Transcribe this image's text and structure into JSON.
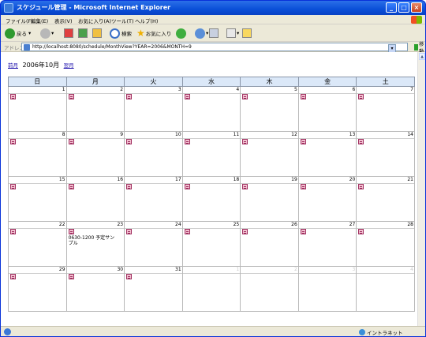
{
  "window": {
    "title": "スケジュール管理 - Microsoft Internet Explorer"
  },
  "menu": [
    "ファイル(F)",
    "編集(E)",
    "表示(V)",
    "お気に入り(A)",
    "ツール(T)",
    "ヘルプ(H)"
  ],
  "toolbar": {
    "back": "戻る",
    "search": "検索",
    "favorites": "お気に入り"
  },
  "address": {
    "label": "アドレス(D)",
    "url": "http://localhost:8080/schedule/MonthView?YEAR=2006&MONTH=9",
    "go": "移動"
  },
  "nav": {
    "prev": "前月",
    "current": "2006年10月",
    "next": "翌月"
  },
  "weekdays": [
    "日",
    "月",
    "火",
    "水",
    "木",
    "金",
    "土"
  ],
  "weeks": [
    [
      {
        "day": "1"
      },
      {
        "day": "2"
      },
      {
        "day": "3"
      },
      {
        "day": "4"
      },
      {
        "day": "5"
      },
      {
        "day": "6"
      },
      {
        "day": "7"
      }
    ],
    [
      {
        "day": "8"
      },
      {
        "day": "9"
      },
      {
        "day": "10"
      },
      {
        "day": "11"
      },
      {
        "day": "12"
      },
      {
        "day": "13"
      },
      {
        "day": "14"
      }
    ],
    [
      {
        "day": "15"
      },
      {
        "day": "16"
      },
      {
        "day": "17"
      },
      {
        "day": "18"
      },
      {
        "day": "19"
      },
      {
        "day": "20"
      },
      {
        "day": "21"
      }
    ],
    [
      {
        "day": "22"
      },
      {
        "day": "23",
        "event": "0630-1200 予定サンプル"
      },
      {
        "day": "24"
      },
      {
        "day": "25"
      },
      {
        "day": "26"
      },
      {
        "day": "27"
      },
      {
        "day": "28"
      }
    ],
    [
      {
        "day": "29"
      },
      {
        "day": "30"
      },
      {
        "day": "31"
      },
      {
        "day": "1",
        "other": true
      },
      {
        "day": "2",
        "other": true
      },
      {
        "day": "3",
        "other": true
      },
      {
        "day": "4",
        "other": true
      }
    ]
  ],
  "status": {
    "zone": "イントラネット"
  }
}
